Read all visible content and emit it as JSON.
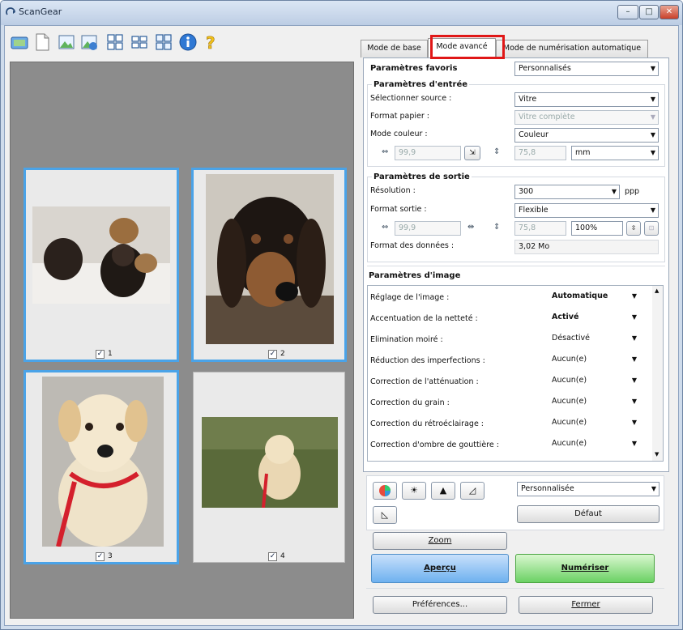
{
  "window": {
    "title": "ScanGear",
    "controls": {
      "minimize": "–",
      "maximize": "□",
      "close": "✕"
    }
  },
  "toolbar": {
    "icons": [
      "scan-icon",
      "document-icon",
      "image-icon",
      "image-icon",
      "grid-icon",
      "grid-icon",
      "grid-icon",
      "info-icon",
      "help-icon"
    ]
  },
  "thumbnails": [
    {
      "label": "1",
      "checked": true,
      "selected": true
    },
    {
      "label": "2",
      "checked": true,
      "selected": true
    },
    {
      "label": "3",
      "checked": true,
      "selected": true
    },
    {
      "label": "4",
      "checked": true,
      "selected": false
    }
  ],
  "tabs": [
    "Mode de base",
    "Mode avancé",
    "Mode de numérisation automatique"
  ],
  "favorites": {
    "label": "Paramètres favoris",
    "value": "Personnalisés"
  },
  "input": {
    "title": "Paramètres d'entrée",
    "source_label": "Sélectionner source :",
    "source_value": "Vitre",
    "paper_label": "Format papier :",
    "paper_value": "Vitre complète",
    "color_label": "Mode couleur :",
    "color_value": "Couleur",
    "width": "99,9",
    "height": "75,8",
    "unit": "mm"
  },
  "output": {
    "title": "Paramètres de sortie",
    "res_label": "Résolution :",
    "res_value": "300",
    "res_unit": "ppp",
    "format_label": "Format sortie :",
    "format_value": "Flexible",
    "width": "99,9",
    "height": "75,8",
    "scale": "100%",
    "data_label": "Format des données :",
    "data_value": "3,02 Mo"
  },
  "image_settings": {
    "title": "Paramètres d'image",
    "rows": [
      {
        "label": "Réglage de l'image :",
        "value": "Automatique",
        "bold": true
      },
      {
        "label": "Accentuation de la netteté :",
        "value": "Activé",
        "bold": true
      },
      {
        "label": "Elimination moiré :",
        "value": "Désactivé",
        "bold": false
      },
      {
        "label": "Réduction des imperfections :",
        "value": "Aucun(e)",
        "bold": false
      },
      {
        "label": "Correction de l'atténuation :",
        "value": "Aucun(e)",
        "bold": false
      },
      {
        "label": "Correction du grain :",
        "value": "Aucun(e)",
        "bold": false
      },
      {
        "label": "Correction du rétroéclairage :",
        "value": "Aucun(e)",
        "bold": false
      },
      {
        "label": "Correction d'ombre de gouttière :",
        "value": "Aucun(e)",
        "bold": false
      }
    ]
  },
  "adjust": {
    "preset": "Personnalisée",
    "default_btn": "Défaut"
  },
  "buttons": {
    "zoom": "Zoom",
    "preview": "Aperçu",
    "scan": "Numériser",
    "prefs": "Préférences...",
    "close": "Fermer"
  },
  "colors": {
    "highlight": "#e01717",
    "selection": "#4aa3e8",
    "preview_btn": "#6eb1ef",
    "scan_btn": "#6bd164"
  }
}
